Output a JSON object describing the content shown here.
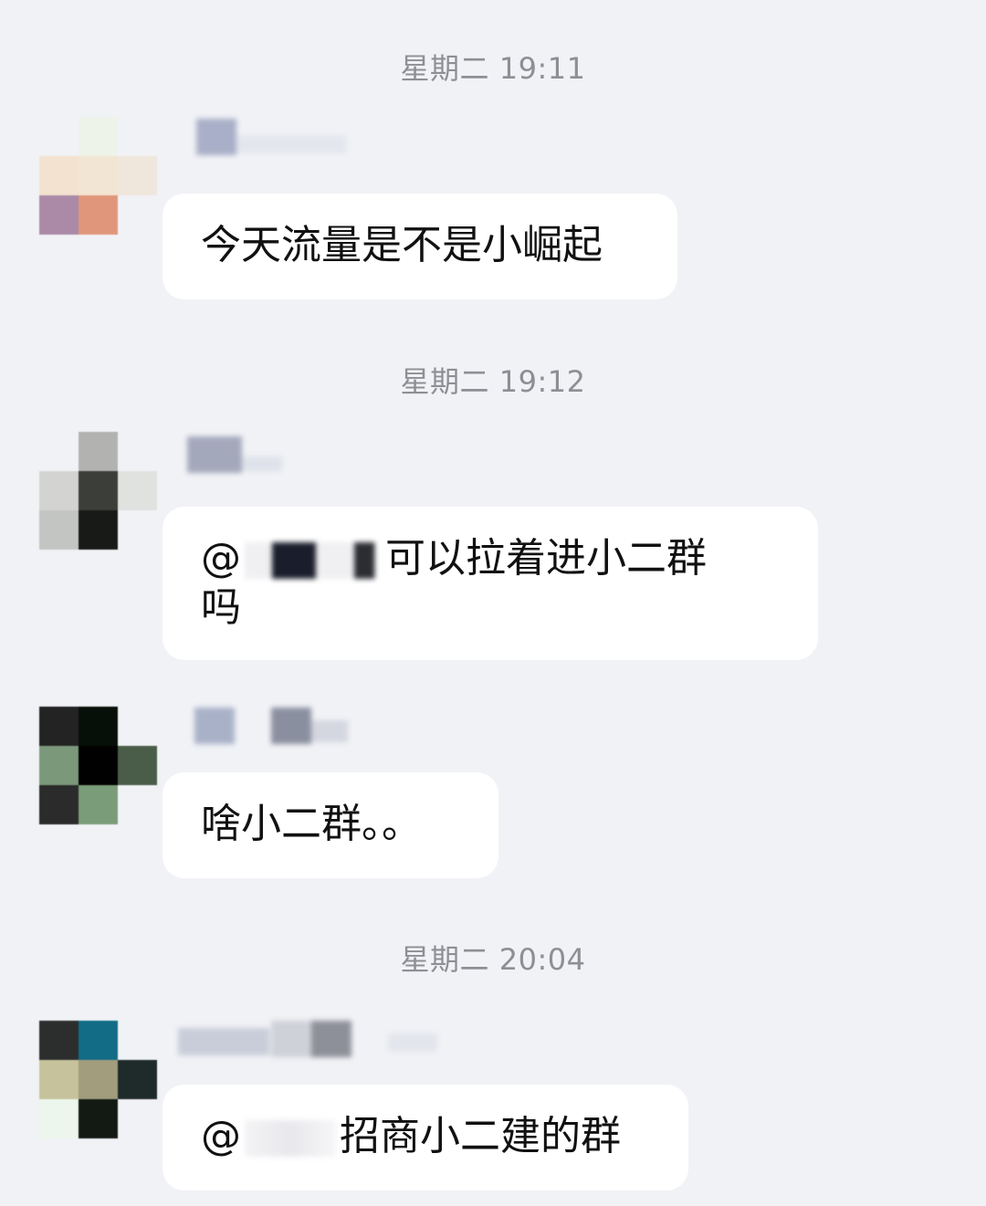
{
  "chat": {
    "messages": [
      {
        "timestamp": "星期二 19:11",
        "text": "今天流量是不是小崛起"
      },
      {
        "timestamp": "星期二 19:12",
        "prefix": "@",
        "text": "可以拉着进小二群",
        "text_line2": "吗"
      },
      {
        "text": "啥小二群。。"
      },
      {
        "timestamp": "星期二 20:04",
        "prefix": "@",
        "text": "招商小二建的群"
      }
    ]
  },
  "colors": {
    "background": "#f1f2f6",
    "bubble": "#ffffff",
    "timestamp": "#8e8f94",
    "text": "#111111"
  }
}
